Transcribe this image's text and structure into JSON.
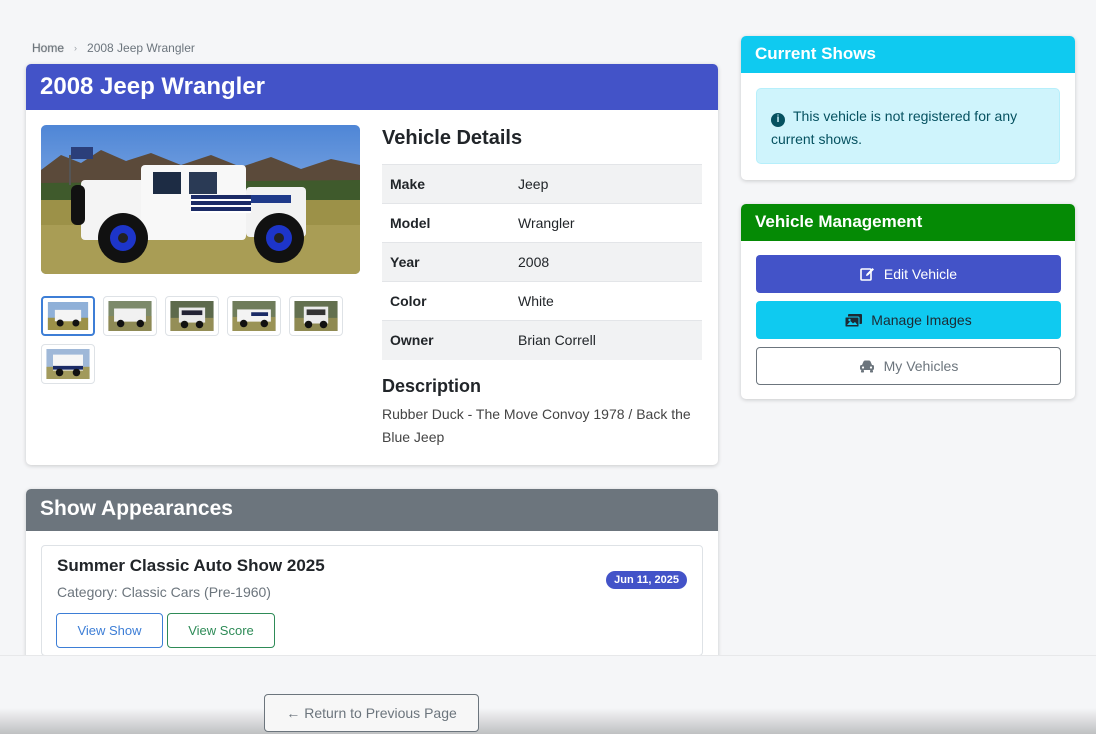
{
  "breadcrumb": {
    "home": "Home",
    "current": "2008 Jeep Wrangler"
  },
  "vehicle": {
    "title": "2008 Jeep Wrangler",
    "details_title": "Vehicle Details",
    "details": [
      {
        "label": "Make",
        "value": "Jeep"
      },
      {
        "label": "Model",
        "value": "Wrangler"
      },
      {
        "label": "Year",
        "value": "2008"
      },
      {
        "label": "Color",
        "value": "White"
      },
      {
        "label": "Owner",
        "value": "Brian Correll"
      }
    ],
    "description_title": "Description",
    "description": "Rubber Duck - The Move Convoy 1978 / Back the Blue Jeep"
  },
  "shows": {
    "title": "Show Appearances",
    "items": [
      {
        "name": "Summer Classic Auto Show 2025",
        "category": "Category: Classic Cars (Pre-1960)",
        "date": "Jun 11, 2025",
        "view_show": "View Show",
        "view_score": "View Score"
      }
    ]
  },
  "current_shows": {
    "title": "Current Shows",
    "message": "This vehicle is not registered for any current shows."
  },
  "management": {
    "title": "Vehicle Management",
    "edit": "Edit Vehicle",
    "images": "Manage Images",
    "my_vehicles": "My Vehicles"
  },
  "return_label": "Return to Previous Page",
  "colors": {
    "primary": "#4353c8",
    "info": "#0fcaf0",
    "success": "#058a05",
    "secondary": "#6c757d"
  }
}
